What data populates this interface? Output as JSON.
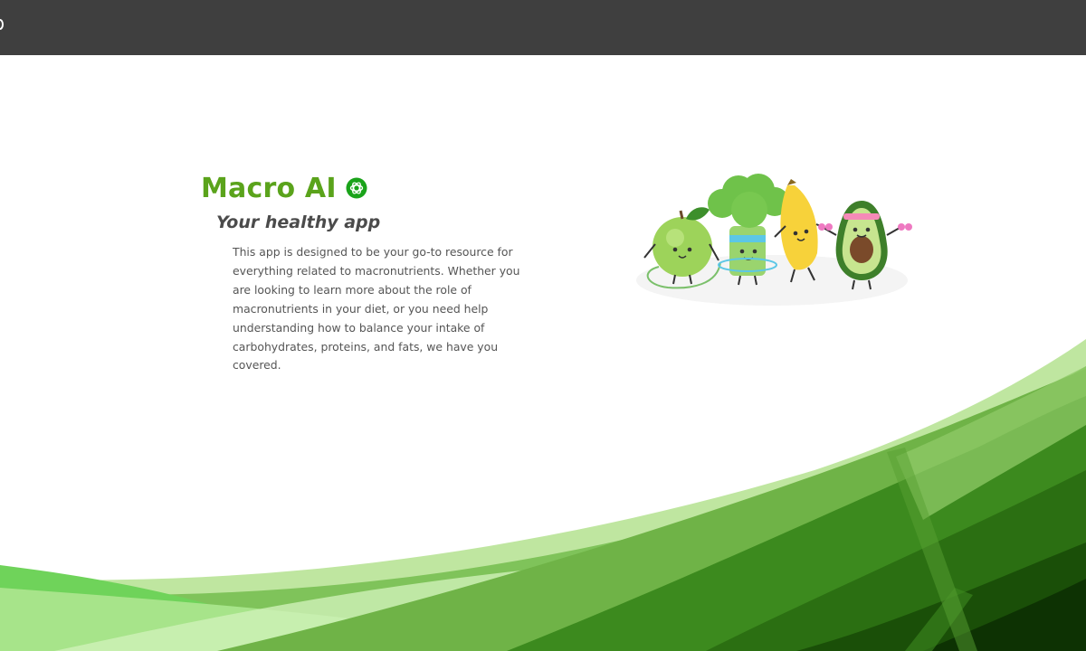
{
  "header": {
    "edge_icon": "circle-icon"
  },
  "hero": {
    "title": "Macro AI",
    "brand_icon": "openai-logo-icon",
    "subtitle": "Your healthy app",
    "description": "This app is designed to be your go-to resource for everything related to macronutrients. Whether you are looking to learn more about the role of macronutrients in your diet, or you need help understanding how to balance your intake of carbohydrates, proteins, and fats, we have you covered."
  },
  "illustration": {
    "characters": [
      "apple",
      "broccoli",
      "banana",
      "avocado"
    ]
  },
  "colors": {
    "topbar": "#3f3f3f",
    "title": "#5aa31b",
    "subtitle": "#4b4b4b",
    "body_text": "#555555",
    "brand_icon": "#1aa31a"
  }
}
